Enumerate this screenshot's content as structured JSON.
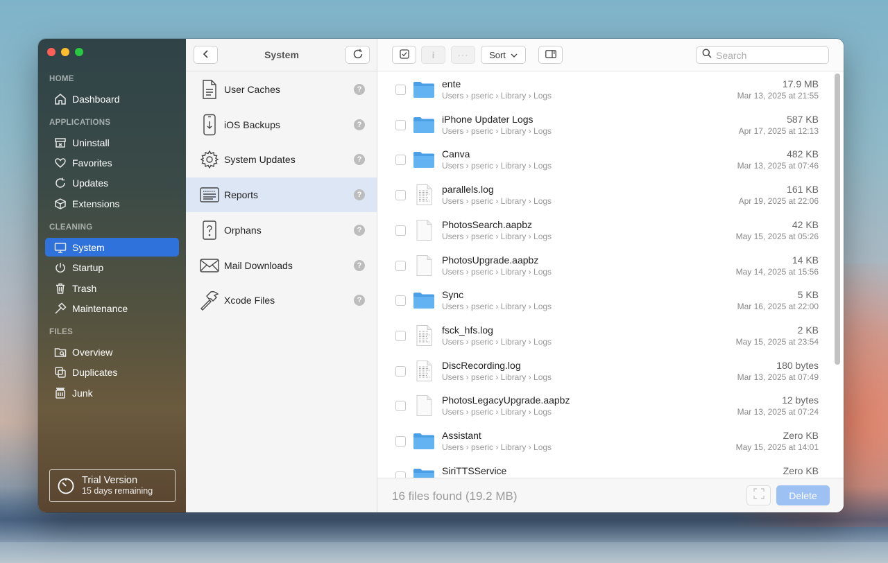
{
  "sidebar": {
    "sections": [
      {
        "label": "HOME",
        "items": [
          {
            "label": "Dashboard",
            "icon": "home-icon"
          }
        ]
      },
      {
        "label": "APPLICATIONS",
        "items": [
          {
            "label": "Uninstall",
            "icon": "uninstall-icon"
          },
          {
            "label": "Favorites",
            "icon": "heart-icon"
          },
          {
            "label": "Updates",
            "icon": "refresh-icon"
          },
          {
            "label": "Extensions",
            "icon": "cube-icon"
          }
        ]
      },
      {
        "label": "CLEANING",
        "items": [
          {
            "label": "System",
            "icon": "monitor-icon",
            "active": true
          },
          {
            "label": "Startup",
            "icon": "power-icon"
          },
          {
            "label": "Trash",
            "icon": "trash-icon"
          },
          {
            "label": "Maintenance",
            "icon": "hammer-icon"
          }
        ]
      },
      {
        "label": "FILES",
        "items": [
          {
            "label": "Overview",
            "icon": "folder-search-icon"
          },
          {
            "label": "Duplicates",
            "icon": "duplicates-icon"
          },
          {
            "label": "Junk",
            "icon": "junk-icon"
          }
        ]
      }
    ],
    "trial": {
      "title": "Trial Version",
      "subtitle": "15 days remaining"
    }
  },
  "middle": {
    "title": "System",
    "categories": [
      {
        "label": "User Caches",
        "icon": "document-icon"
      },
      {
        "label": "iOS Backups",
        "icon": "phone-icon"
      },
      {
        "label": "System Updates",
        "icon": "gear-icon"
      },
      {
        "label": "Reports",
        "icon": "report-icon",
        "active": true
      },
      {
        "label": "Orphans",
        "icon": "question-doc-icon"
      },
      {
        "label": "Mail Downloads",
        "icon": "mail-icon"
      },
      {
        "label": "Xcode Files",
        "icon": "hammer-icon"
      }
    ]
  },
  "toolbar": {
    "sort_label": "Sort",
    "search_placeholder": "Search"
  },
  "files": [
    {
      "name": "ente",
      "path": "Users › pseric › Library › Logs",
      "size": "17.9 MB",
      "date": "Mar 13, 2025 at 21:55",
      "kind": "folder"
    },
    {
      "name": "iPhone Updater Logs",
      "path": "Users › pseric › Library › Logs",
      "size": "587 KB",
      "date": "Apr 17, 2025 at 12:13",
      "kind": "folder"
    },
    {
      "name": "Canva",
      "path": "Users › pseric › Library › Logs",
      "size": "482 KB",
      "date": "Mar 13, 2025 at 07:46",
      "kind": "folder"
    },
    {
      "name": "parallels.log",
      "path": "Users › pseric › Library › Logs",
      "size": "161 KB",
      "date": "Apr 19, 2025 at 22:06",
      "kind": "log"
    },
    {
      "name": "PhotosSearch.aapbz",
      "path": "Users › pseric › Library › Logs",
      "size": "42 KB",
      "date": "May 15, 2025 at 05:26",
      "kind": "file"
    },
    {
      "name": "PhotosUpgrade.aapbz",
      "path": "Users › pseric › Library › Logs",
      "size": "14 KB",
      "date": "May 14, 2025 at 15:56",
      "kind": "file"
    },
    {
      "name": "Sync",
      "path": "Users › pseric › Library › Logs",
      "size": "5 KB",
      "date": "Mar 16, 2025 at 22:00",
      "kind": "folder"
    },
    {
      "name": "fsck_hfs.log",
      "path": "Users › pseric › Library › Logs",
      "size": "2 KB",
      "date": "May 15, 2025 at 23:54",
      "kind": "log"
    },
    {
      "name": "DiscRecording.log",
      "path": "Users › pseric › Library › Logs",
      "size": "180 bytes",
      "date": "Mar 13, 2025 at 07:49",
      "kind": "log"
    },
    {
      "name": "PhotosLegacyUpgrade.aapbz",
      "path": "Users › pseric › Library › Logs",
      "size": "12 bytes",
      "date": "Mar 13, 2025 at 07:24",
      "kind": "file"
    },
    {
      "name": "Assistant",
      "path": "Users › pseric › Library › Logs",
      "size": "Zero KB",
      "date": "May 15, 2025 at 14:01",
      "kind": "folder"
    },
    {
      "name": "SiriTTSService",
      "path": "",
      "size": "Zero KB",
      "date": "",
      "kind": "folder"
    }
  ],
  "footer": {
    "count_text": "16 files found (19.2 MB)",
    "delete_label": "Delete"
  },
  "colors": {
    "accent": "#2f72db",
    "folder": "#5aaef0",
    "delete_disabled": "#9ec1f3"
  }
}
